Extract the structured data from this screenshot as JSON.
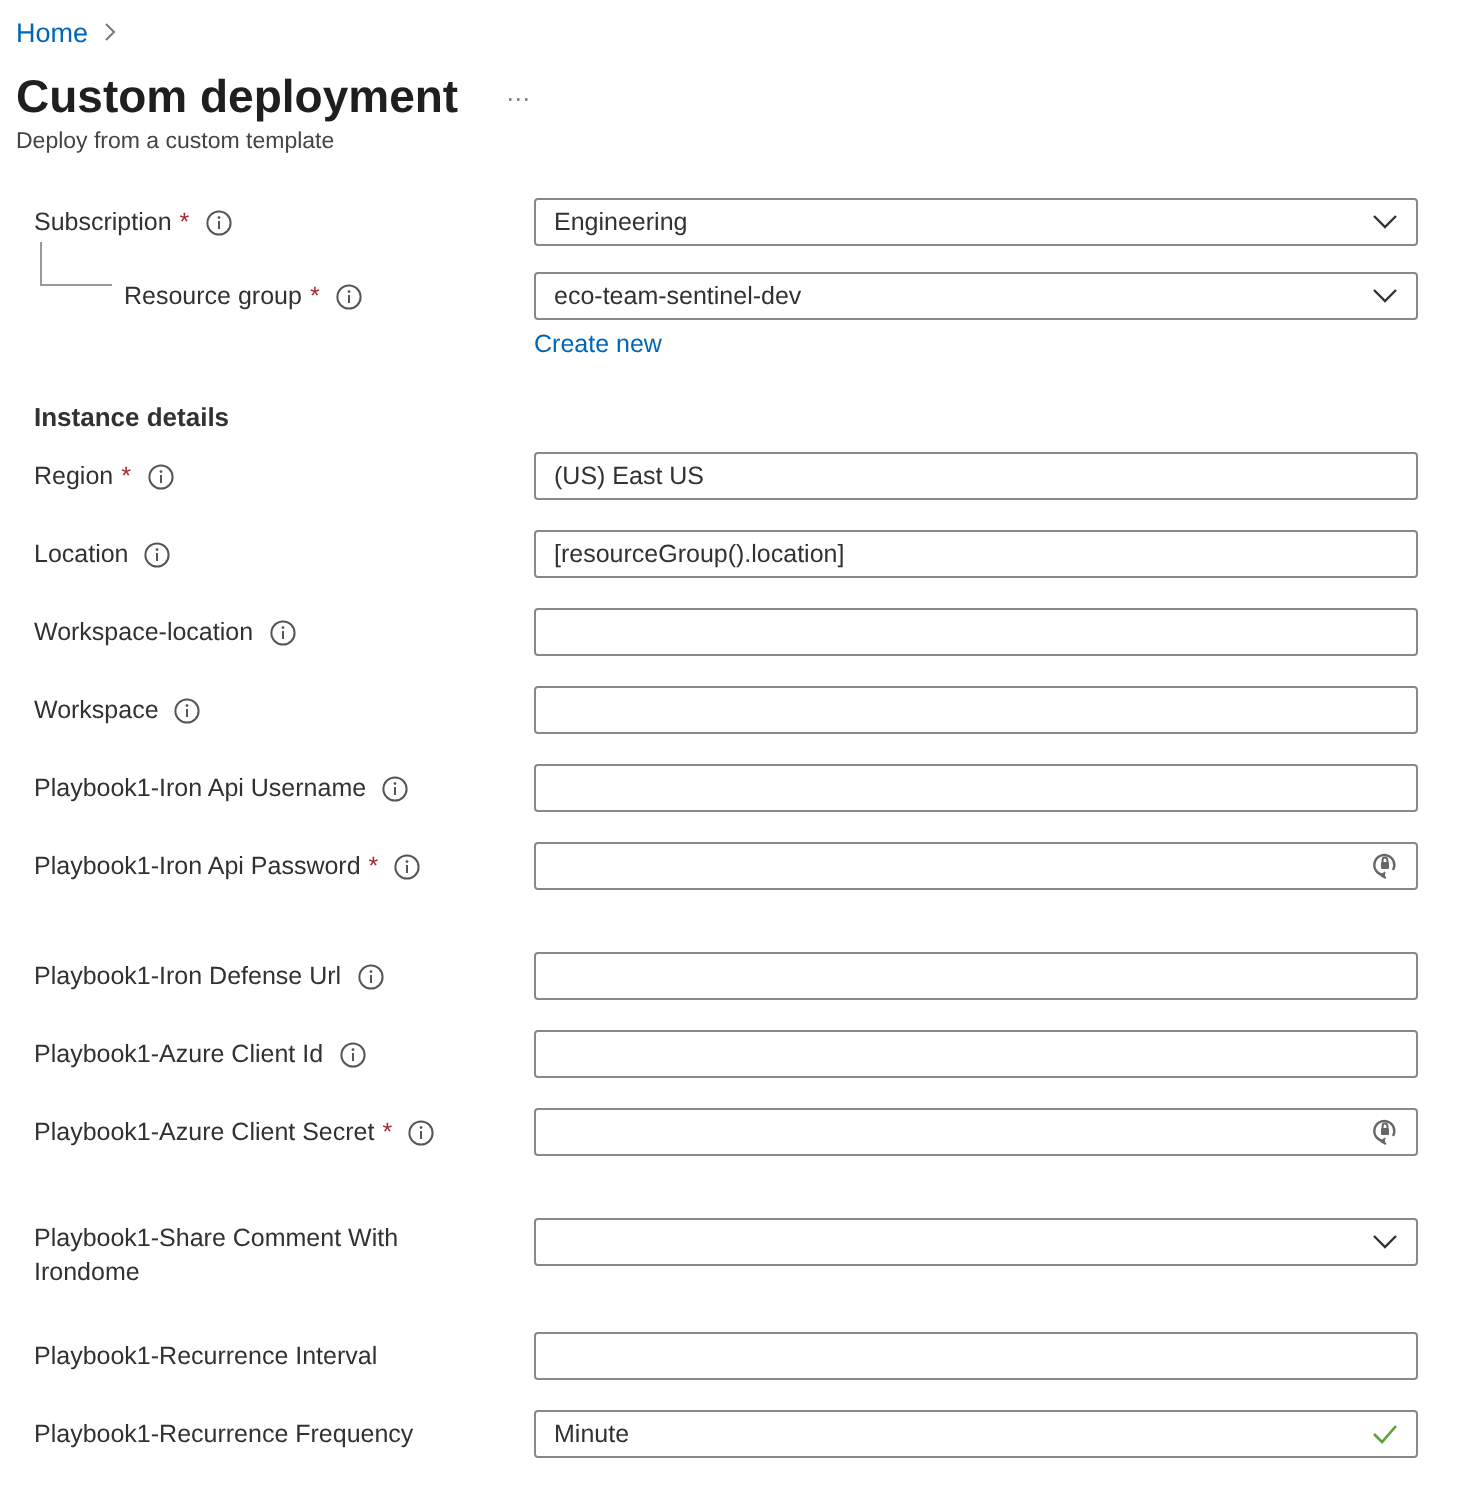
{
  "breadcrumb": {
    "items": [
      "Home"
    ]
  },
  "page": {
    "title": "Custom deployment",
    "more": "···",
    "subtitle": "Deploy from a custom template"
  },
  "project_fields": [
    {
      "label": "Subscription",
      "required_mark": "*",
      "info": true,
      "kind": "dropdown",
      "value": "Engineering",
      "children": [
        {
          "label": "Resource group",
          "required_mark": "*",
          "info": true,
          "kind": "dropdown",
          "value": "eco-team-sentinel-dev",
          "link": "Create new"
        }
      ]
    }
  ],
  "instance_heading": "Instance details",
  "instance_fields": [
    {
      "label": "Region",
      "required_mark": "*",
      "info": true,
      "kind": "text",
      "value": "(US) East US"
    },
    {
      "label": "Location",
      "info": true,
      "kind": "text",
      "value": "[resourceGroup().location]"
    },
    {
      "label": "Workspace-location",
      "info": true,
      "kind": "text"
    },
    {
      "label": "Workspace",
      "info": true,
      "kind": "text"
    },
    {
      "label": "Playbook1-Iron Api Username",
      "info": true,
      "kind": "text"
    },
    {
      "label": "Playbook1-Iron Api Password",
      "required_mark": "*",
      "info": true,
      "kind": "password"
    },
    {
      "label": "Playbook1-Iron Defense Url",
      "info": true,
      "kind": "text"
    },
    {
      "label": "Playbook1-Azure Client Id",
      "info": true,
      "kind": "text"
    },
    {
      "label": "Playbook1-Azure Client Secret",
      "required_mark": "*",
      "info": true,
      "kind": "password"
    },
    {
      "label": "Playbook1-Share Comment With Irondome",
      "info": false,
      "kind": "dropdown"
    },
    {
      "label": "Playbook1-Recurrence Interval",
      "info": false,
      "kind": "text"
    },
    {
      "label": "Playbook1-Recurrence Frequency",
      "info": false,
      "kind": "valid",
      "value": "Minute"
    }
  ]
}
